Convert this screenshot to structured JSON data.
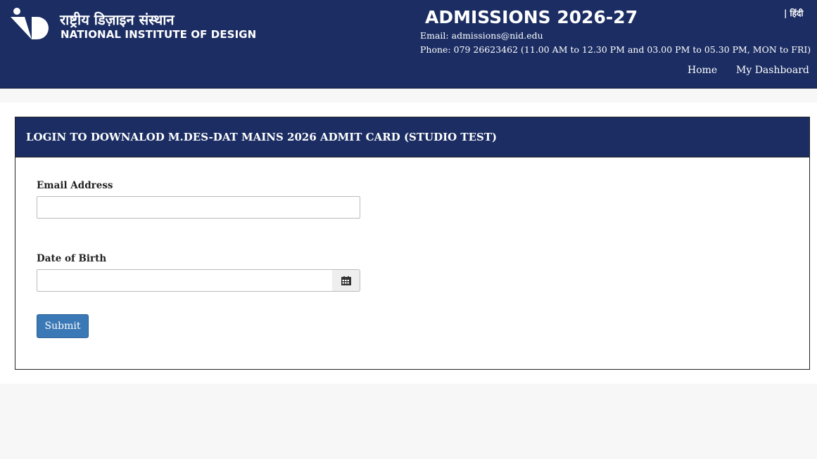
{
  "header": {
    "brand_hindi": "राष्ट्रीय डिज़ाइन संस्थान",
    "brand_english": "NATIONAL INSTITUTE OF DESIGN",
    "admissions_title": "ADMISSIONS 2026-27",
    "email_line": "Email: admissions@nid.edu",
    "phone_line": "Phone: 079 26623462 (11.00 AM to 12.30 PM and 03.00 PM to 05.30 PM, MON to FRI)",
    "language_link": "| हिंदी",
    "nav": {
      "home": "Home",
      "dashboard": "My Dashboard"
    }
  },
  "panel": {
    "title": "LOGIN TO DOWNALOD M.DES-DAT MAINS 2026 ADMIT CARD (STUDIO TEST)"
  },
  "form": {
    "email_label": "Email Address",
    "email_value": "",
    "email_placeholder": "",
    "dob_label": "Date of Birth",
    "dob_value": "",
    "dob_placeholder": "",
    "calendar_icon": "calendar-icon",
    "submit_label": "Submit"
  },
  "colors": {
    "header_bg": "#1b2d63",
    "submit_bg": "#3a78b6"
  }
}
